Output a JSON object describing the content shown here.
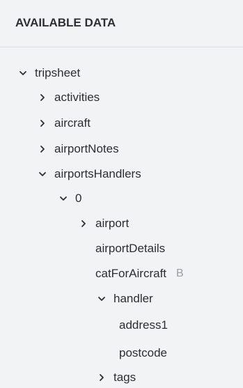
{
  "panel": {
    "title": "AVAILABLE DATA"
  },
  "tree": {
    "nodes": [
      {
        "label": "tripsheet",
        "state": "expanded",
        "icon": "chevron-down-icon"
      },
      {
        "label": "activities",
        "state": "collapsed",
        "icon": "chevron-right-icon"
      },
      {
        "label": "aircraft",
        "state": "collapsed",
        "icon": "chevron-right-icon"
      },
      {
        "label": "airportNotes",
        "state": "collapsed",
        "icon": "chevron-right-icon"
      },
      {
        "label": "airportsHandlers",
        "state": "expanded",
        "icon": "chevron-down-icon"
      },
      {
        "label": "0",
        "state": "expanded",
        "icon": "chevron-down-icon"
      },
      {
        "label": "airport",
        "state": "collapsed",
        "icon": "chevron-right-icon"
      },
      {
        "label": "airportDetails",
        "state": "leaf"
      },
      {
        "label": "catForAircraft",
        "state": "leaf",
        "badge": "B"
      },
      {
        "label": "handler",
        "state": "expanded",
        "icon": "chevron-down-icon"
      },
      {
        "label": "address1",
        "state": "leaf"
      },
      {
        "label": "postcode",
        "state": "leaf"
      },
      {
        "label": "tags",
        "state": "collapsed",
        "icon": "chevron-right-icon"
      }
    ]
  },
  "colors": {
    "background": "#f1f3f4",
    "text": "#2b2e33",
    "muted": "#9aa0a6",
    "divider": "#d8dce0"
  }
}
